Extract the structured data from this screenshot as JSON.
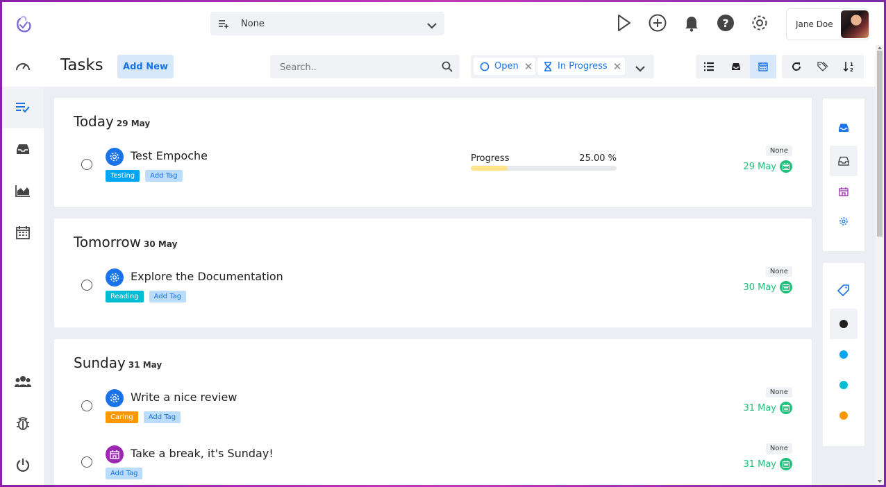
{
  "topbar": {
    "project_select": {
      "label": "None"
    },
    "user": {
      "name": "Jane Doe"
    }
  },
  "header": {
    "title": "Tasks",
    "add_new_label": "Add New",
    "search_placeholder": "Search..",
    "filters": [
      {
        "label": "Open",
        "icon": "circle-icon"
      },
      {
        "label": "In Progress",
        "icon": "hourglass-icon"
      }
    ]
  },
  "groups": [
    {
      "title": "Today",
      "date": "29 May",
      "tasks": [
        {
          "name": "Test Empoche",
          "icon": "gear-icon",
          "tags": [
            {
              "label": "Testing",
              "color": "#00a5f4"
            }
          ],
          "add_tag": "Add Tag",
          "priority": "None",
          "due": "29 May",
          "progress": {
            "label": "Progress",
            "value_text": "25.00 %",
            "percent": 25
          }
        }
      ]
    },
    {
      "title": "Tomorrow",
      "date": "30 May",
      "tasks": [
        {
          "name": "Explore the Documentation",
          "icon": "gear-icon",
          "tags": [
            {
              "label": "Reading",
              "color": "#00bcd4"
            }
          ],
          "add_tag": "Add Tag",
          "priority": "None",
          "due": "30 May"
        }
      ]
    },
    {
      "title": "Sunday",
      "date": "31 May",
      "tasks": [
        {
          "name": "Write a nice review",
          "icon": "gear-icon",
          "tags": [
            {
              "label": "Caring",
              "color": "#ff9800"
            }
          ],
          "add_tag": "Add Tag",
          "priority": "None",
          "due": "31 May"
        },
        {
          "name": "Take a break, it's Sunday!",
          "icon": "calendar-home-icon",
          "tags": [],
          "add_tag": "Add Tag",
          "priority": "None",
          "due": "31 May"
        }
      ]
    }
  ],
  "colors": {
    "accent": "#1a73e8",
    "due_green": "#21c17b",
    "purple_icon": "#9c27b0",
    "dot_colors": [
      "#212121",
      "#00a5f4",
      "#00bcd4",
      "#ff9800"
    ]
  }
}
